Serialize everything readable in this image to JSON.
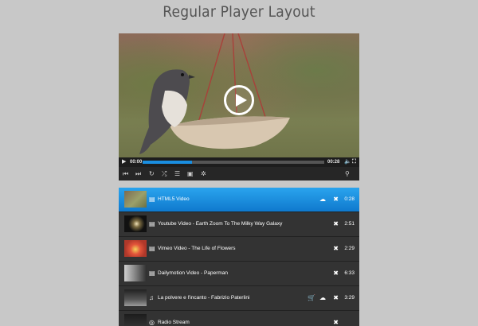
{
  "page": {
    "title": "Regular Player Layout"
  },
  "player": {
    "current_time": "00:00",
    "duration": "00:28",
    "progress_fraction": 0.27,
    "accent_color": "#1a8ee0",
    "icons_row1": [
      "play-icon",
      "volume-icon",
      "fullscreen-icon"
    ],
    "icons_row2": [
      "previous-icon",
      "next-icon",
      "repeat-icon",
      "shuffle-icon",
      "playlist-icon",
      "share-icon",
      "settings-icon",
      "search-icon"
    ]
  },
  "playlist": {
    "active_color": "#1a8ee0",
    "items": [
      {
        "title": "HTML5 Video",
        "duration": "0:28",
        "type_icon": "film-icon",
        "download": true,
        "active": true
      },
      {
        "title": "Youtube Video - Earth Zoom To The Milky Way Galaxy",
        "duration": "2:51",
        "type_icon": "film-icon",
        "download": false,
        "active": false
      },
      {
        "title": "Vimeo Video - The Life of Flowers",
        "duration": "2:29",
        "type_icon": "film-icon",
        "download": false,
        "active": false
      },
      {
        "title": "Dailymotion Video - Paperman",
        "duration": "6:33",
        "type_icon": "film-icon",
        "download": false,
        "active": false
      },
      {
        "title": "La polvere e l'incanto - Fabrizio Paterlini",
        "duration": "3:29",
        "type_icon": "music-icon",
        "download": true,
        "cart": true,
        "active": false
      },
      {
        "title": "Radio Stream",
        "duration": "",
        "type_icon": "radio-icon",
        "download": false,
        "active": false
      }
    ]
  }
}
